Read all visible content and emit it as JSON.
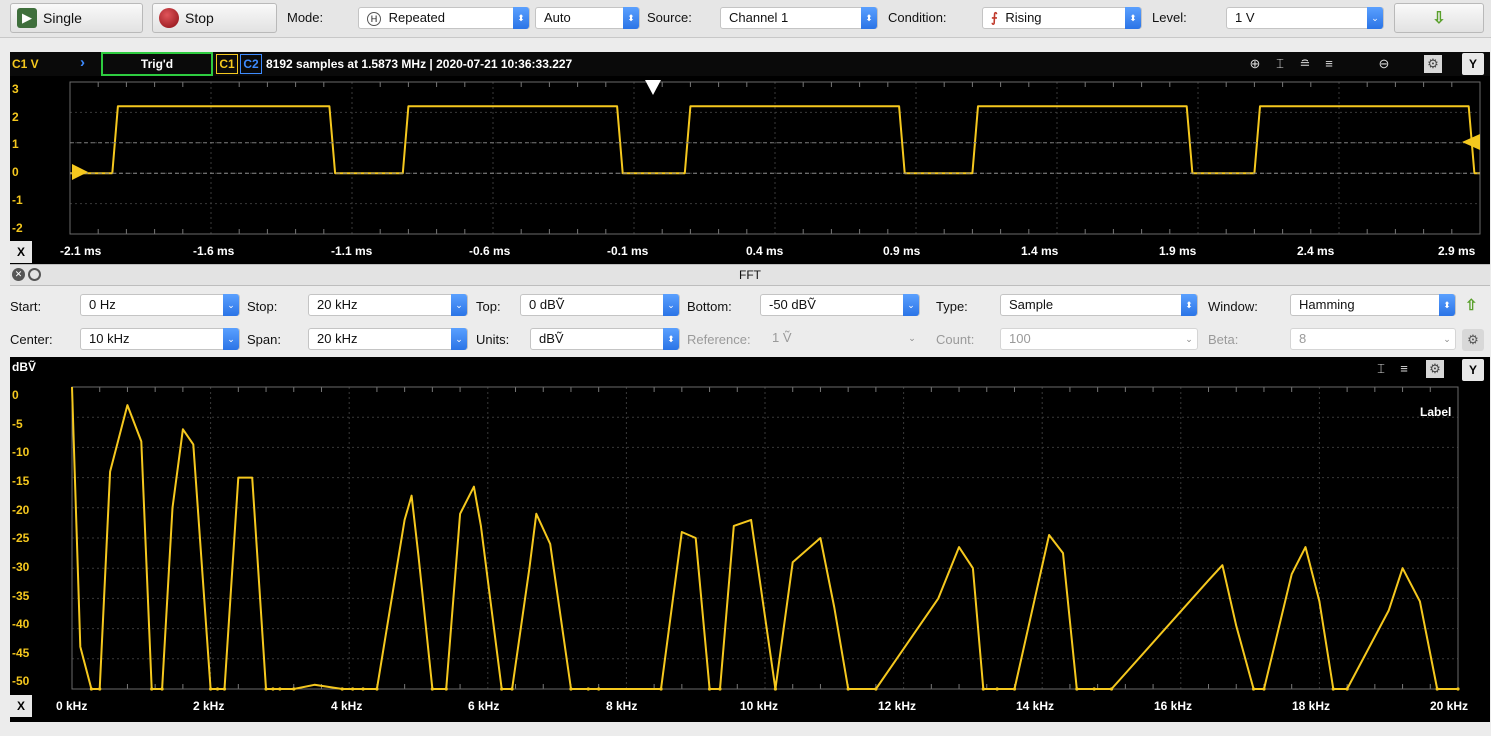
{
  "toolbar": {
    "single_label": "Single",
    "stop_label": "Stop",
    "mode_label": "Mode:",
    "mode_value": "Repeated",
    "mode_badge": "H",
    "auto_value": "Auto",
    "source_label": "Source:",
    "source_value": "Channel 1",
    "condition_label": "Condition:",
    "condition_value": "Rising",
    "level_label": "Level:",
    "level_value": "1 V",
    "download_icon": "down-arrow-icon"
  },
  "scope": {
    "channel_label": "C1 V",
    "trig_status": "Trig'd",
    "c1": "C1",
    "c2": "C2",
    "acq_info": "8192 samples at 1.5873 MHz | 2020-07-21 10:36:33.227",
    "y_button": "Y",
    "x_button": "X",
    "y_ticks": [
      "3",
      "2",
      "1",
      "0",
      "-1",
      "-2"
    ],
    "x_ticks": [
      "-2.1 ms",
      "-1.6 ms",
      "-1.1 ms",
      "-0.6 ms",
      "-0.1 ms",
      "0.4 ms",
      "0.9 ms",
      "1.4 ms",
      "1.9 ms",
      "2.4 ms",
      "2.9 ms"
    ],
    "trace_color": "#f5c81e"
  },
  "fft": {
    "title": "FFT",
    "start_label": "Start:",
    "start_value": "0 Hz",
    "stop_label": "Stop:",
    "stop_value": "20 kHz",
    "top_label": "Top:",
    "top_value": "0 dBṼ",
    "bottom_label": "Bottom:",
    "bottom_value": "-50 dBṼ",
    "type_label": "Type:",
    "type_value": "Sample",
    "window_label": "Window:",
    "window_value": "Hamming",
    "center_label": "Center:",
    "center_value": "10 kHz",
    "span_label": "Span:",
    "span_value": "20 kHz",
    "units_label": "Units:",
    "units_value": "dBṼ",
    "reference_label": "Reference:",
    "reference_value": "1 Ṽ",
    "count_label": "Count:",
    "count_value": "100",
    "beta_label": "Beta:",
    "beta_value": "8",
    "y_unit": "dBṼ",
    "y_button": "Y",
    "x_button": "X",
    "trace_label": "Label",
    "y_ticks": [
      "0",
      "-5",
      "-10",
      "-15",
      "-20",
      "-25",
      "-30",
      "-35",
      "-40",
      "-45",
      "-50"
    ],
    "x_ticks": [
      "0 kHz",
      "2 kHz",
      "4 kHz",
      "6 kHz",
      "8 kHz",
      "10 kHz",
      "12 kHz",
      "14 kHz",
      "16 kHz",
      "18 kHz",
      "20 kHz"
    ]
  },
  "chart_data": [
    {
      "type": "line",
      "title": "",
      "xlabel": "",
      "ylabel": "C1 V",
      "xlim": [
        -2.1,
        2.9
      ],
      "ylim": [
        -2,
        3
      ],
      "x_unit": "ms",
      "grid": true,
      "series": [
        {
          "x": [
            -2.1,
            -1.95,
            -1.93,
            -1.18,
            -1.16,
            -0.92,
            -0.9,
            -0.16,
            -0.14,
            0.08,
            0.1,
            0.84,
            0.86,
            1.1,
            1.12,
            1.86,
            1.88,
            2.1,
            2.12,
            2.86,
            2.88,
            2.9
          ],
          "y": [
            0,
            0,
            2.2,
            2.2,
            0,
            0,
            2.2,
            2.2,
            0,
            0,
            2.2,
            2.2,
            0,
            0,
            2.2,
            2.2,
            0,
            0,
            2.2,
            2.2,
            0,
            0
          ]
        }
      ]
    },
    {
      "type": "line",
      "title": "FFT",
      "xlabel": "",
      "ylabel": "dBṼ",
      "xlim": [
        0,
        20
      ],
      "ylim": [
        -50,
        0
      ],
      "x_unit": "kHz",
      "grid": true,
      "series": [
        {
          "name": "Label",
          "x": [
            0.0,
            0.12,
            0.28,
            0.4,
            0.55,
            0.8,
            1.0,
            1.15,
            1.3,
            1.45,
            1.6,
            1.75,
            2.0,
            2.1,
            2.2,
            2.4,
            2.6,
            2.8,
            2.9,
            3.0,
            3.2,
            3.5,
            3.9,
            4.05,
            4.2,
            4.4,
            4.8,
            4.9,
            5.0,
            5.2,
            5.4,
            5.6,
            5.8,
            5.9,
            6.2,
            6.35,
            6.6,
            6.7,
            6.9,
            7.2,
            7.45,
            7.6,
            8.5,
            8.8,
            9.0,
            9.2,
            9.35,
            9.55,
            9.8,
            10.15,
            10.4,
            10.8,
            11.0,
            11.2,
            11.6,
            12.5,
            12.8,
            13.0,
            13.15,
            13.35,
            13.6,
            14.1,
            14.3,
            14.5,
            14.75,
            15.0,
            16.4,
            16.6,
            16.8,
            17.05,
            17.2,
            17.6,
            17.8,
            18.0,
            18.2,
            18.4,
            19.0,
            19.2,
            19.45,
            19.7,
            20.0
          ],
          "y": [
            0,
            -43,
            -50,
            -50,
            -14,
            -3,
            -9,
            -50,
            -50,
            -20,
            -7,
            -9.5,
            -50,
            -50,
            -50,
            -15,
            -15,
            -50,
            -50,
            -50,
            -50,
            -49.3,
            -50,
            -50,
            -50,
            -50,
            -22,
            -18,
            -28,
            -50,
            -50,
            -21,
            -16.5,
            -23,
            -50,
            -50,
            -30,
            -21,
            -26,
            -50,
            -50,
            -50,
            -50,
            -24,
            -25,
            -50,
            -50,
            -23,
            -22,
            -50,
            -29,
            -25,
            -36.5,
            -50,
            -50,
            -35,
            -26.5,
            -30,
            -50,
            -50,
            -50,
            -24.5,
            -27.5,
            -50,
            -50,
            -50,
            -32,
            -29.5,
            -39.5,
            -50,
            -50,
            -31,
            -26.5,
            -35.5,
            -50,
            -50,
            -37,
            -30,
            -35.5,
            -50,
            -50
          ]
        }
      ]
    }
  ]
}
